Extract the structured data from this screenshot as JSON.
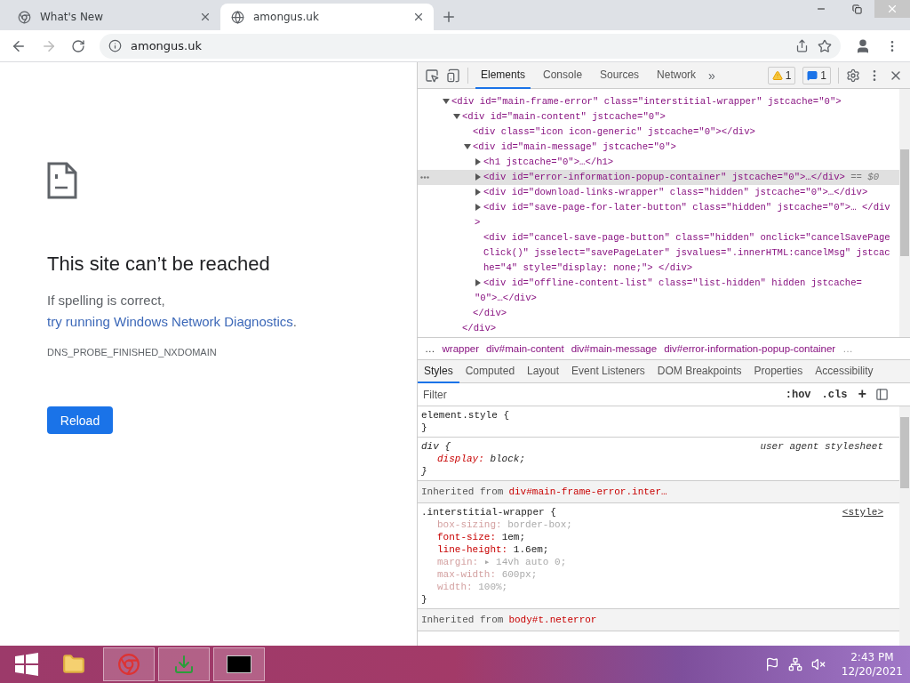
{
  "browser_tabs": [
    {
      "title": "What's New",
      "selected": false,
      "kind": "browser"
    },
    {
      "title": "amongus.uk",
      "selected": true,
      "kind": "globe"
    }
  ],
  "address_bar": {
    "url": "amongus.uk"
  },
  "error_page": {
    "heading": "This site can’t be reached",
    "message": "If spelling is correct, ",
    "link": "try running Windows Network Diagnostics",
    "message_end": ".",
    "error_code": "DNS_PROBE_FINISHED_NXDOMAIN",
    "button": "Reload"
  },
  "devtools": {
    "tabs": [
      {
        "label": "Elements",
        "selected": true
      },
      {
        "label": "Console",
        "selected": false
      },
      {
        "label": "Sources",
        "selected": false
      },
      {
        "label": "Network",
        "selected": false
      }
    ],
    "more_tabs": "»",
    "warnings": "1",
    "messages": "1",
    "dom_tree": [
      {
        "text": "<div id=\"main-frame-error\" class=\"interstitial-wrapper\" jstcache=\"0\">",
        "expanded": true,
        "selected": false,
        "children": [
          {
            "text": "<div id=\"main-content\" jstcache=\"0\">",
            "expanded": true,
            "selected": false,
            "close": "</div>",
            "children": [
              {
                "text": "<div class=\"icon icon-generic\" jstcache=\"0\"></div>",
                "kind": "leaf",
                "selected": false
              },
              {
                "text": "<div id=\"main-message\" jstcache=\"0\">",
                "expanded": true,
                "selected": false,
                "close": "</div>",
                "children": [
                  {
                    "text": "<h1 jstcache=\"0\">…</h1>",
                    "expanded": false,
                    "selected": false
                  },
                  {
                    "text": "<div id=\"error-information-popup-container\" jstcache=\"0\">…</div>",
                    "expanded": false,
                    "selected": true,
                    "marker": "== $0"
                  },
                  {
                    "text": "<div id=\"download-links-wrapper\" class=\"hidden\" jstcache=\"0\">…</div>",
                    "expanded": false,
                    "selected": false
                  },
                  {
                    "text": "<div id=\"save-page-for-later-button\" class=\"hidden\" jstcache=\"0\">… </div>",
                    "expanded": false,
                    "selected": false
                  },
                  {
                    "text": "<div id=\"cancel-save-page-button\" class=\"hidden\" onclick=\"cancelSavePageClick()\" jsselect=\"savePageLater\" jsvalues=\".innerHTML:cancelMsg\" jstcache=\"4\" style=\"display: none;\"> </div>",
                    "kind": "leaf",
                    "selected": false
                  },
                  {
                    "text": "<div id=\"offline-content-list\" class=\"list-hidden\" hidden jstcache= \"0\">…</div>",
                    "expanded": false,
                    "selected": false
                  }
                ]
              }
            ]
          }
        ]
      }
    ],
    "breadcrumbs": {
      "overflow_left": "…",
      "items": [
        "wrapper",
        "div#main-content",
        "div#main-message",
        "div#error-information-popup-container"
      ],
      "overflow_right": "…"
    },
    "panel_tabs": [
      {
        "label": "Styles",
        "selected": true
      },
      {
        "label": "Computed",
        "selected": false
      },
      {
        "label": "Layout",
        "selected": false
      },
      {
        "label": "Event Listeners",
        "selected": false
      },
      {
        "label": "DOM Breakpoints",
        "selected": false
      },
      {
        "label": "Properties",
        "selected": false
      },
      {
        "label": "Accessibility",
        "selected": false
      }
    ],
    "filter": {
      "placeholder": "Filter",
      "hov": ":hov",
      "cls": ".cls",
      "add": "+"
    },
    "styles": [
      {
        "kind": "rule",
        "selector": "element.style {",
        "end": "}"
      },
      {
        "kind": "ua-rule",
        "selector": "div {",
        "source": "user agent stylesheet",
        "end": "}",
        "properties": [
          {
            "name": "display:",
            "value": "block;",
            "inactive": false
          }
        ]
      },
      {
        "kind": "inherited",
        "label": "Inherited from",
        "selector": "div#main-frame-error.inter…"
      },
      {
        "kind": "rule",
        "selector": ".interstitial-wrapper {",
        "source": "<style>",
        "end": "}",
        "properties": [
          {
            "name": "box-sizing:",
            "value": "border-box;",
            "inactive": true
          },
          {
            "name": "font-size:",
            "value": "1em;",
            "inactive": false
          },
          {
            "name": "line-height:",
            "value": "1.6em;",
            "inactive": false
          },
          {
            "name": "margin:",
            "value": "▸ 14vh auto 0;",
            "inactive": true
          },
          {
            "name": "max-width:",
            "value": "600px;",
            "inactive": true
          },
          {
            "name": "width:",
            "value": "100%;",
            "inactive": true
          }
        ]
      },
      {
        "kind": "inherited",
        "label": "Inherited from",
        "selector": "body#t.neterror"
      }
    ]
  },
  "taskbar": {
    "apps": [
      {
        "kind": "folder",
        "running": false
      },
      {
        "kind": "browser",
        "running": true
      },
      {
        "kind": "download",
        "running": true
      },
      {
        "kind": "terminal",
        "running": true
      }
    ],
    "time": "2:43 PM",
    "date": "12/20/2021"
  }
}
